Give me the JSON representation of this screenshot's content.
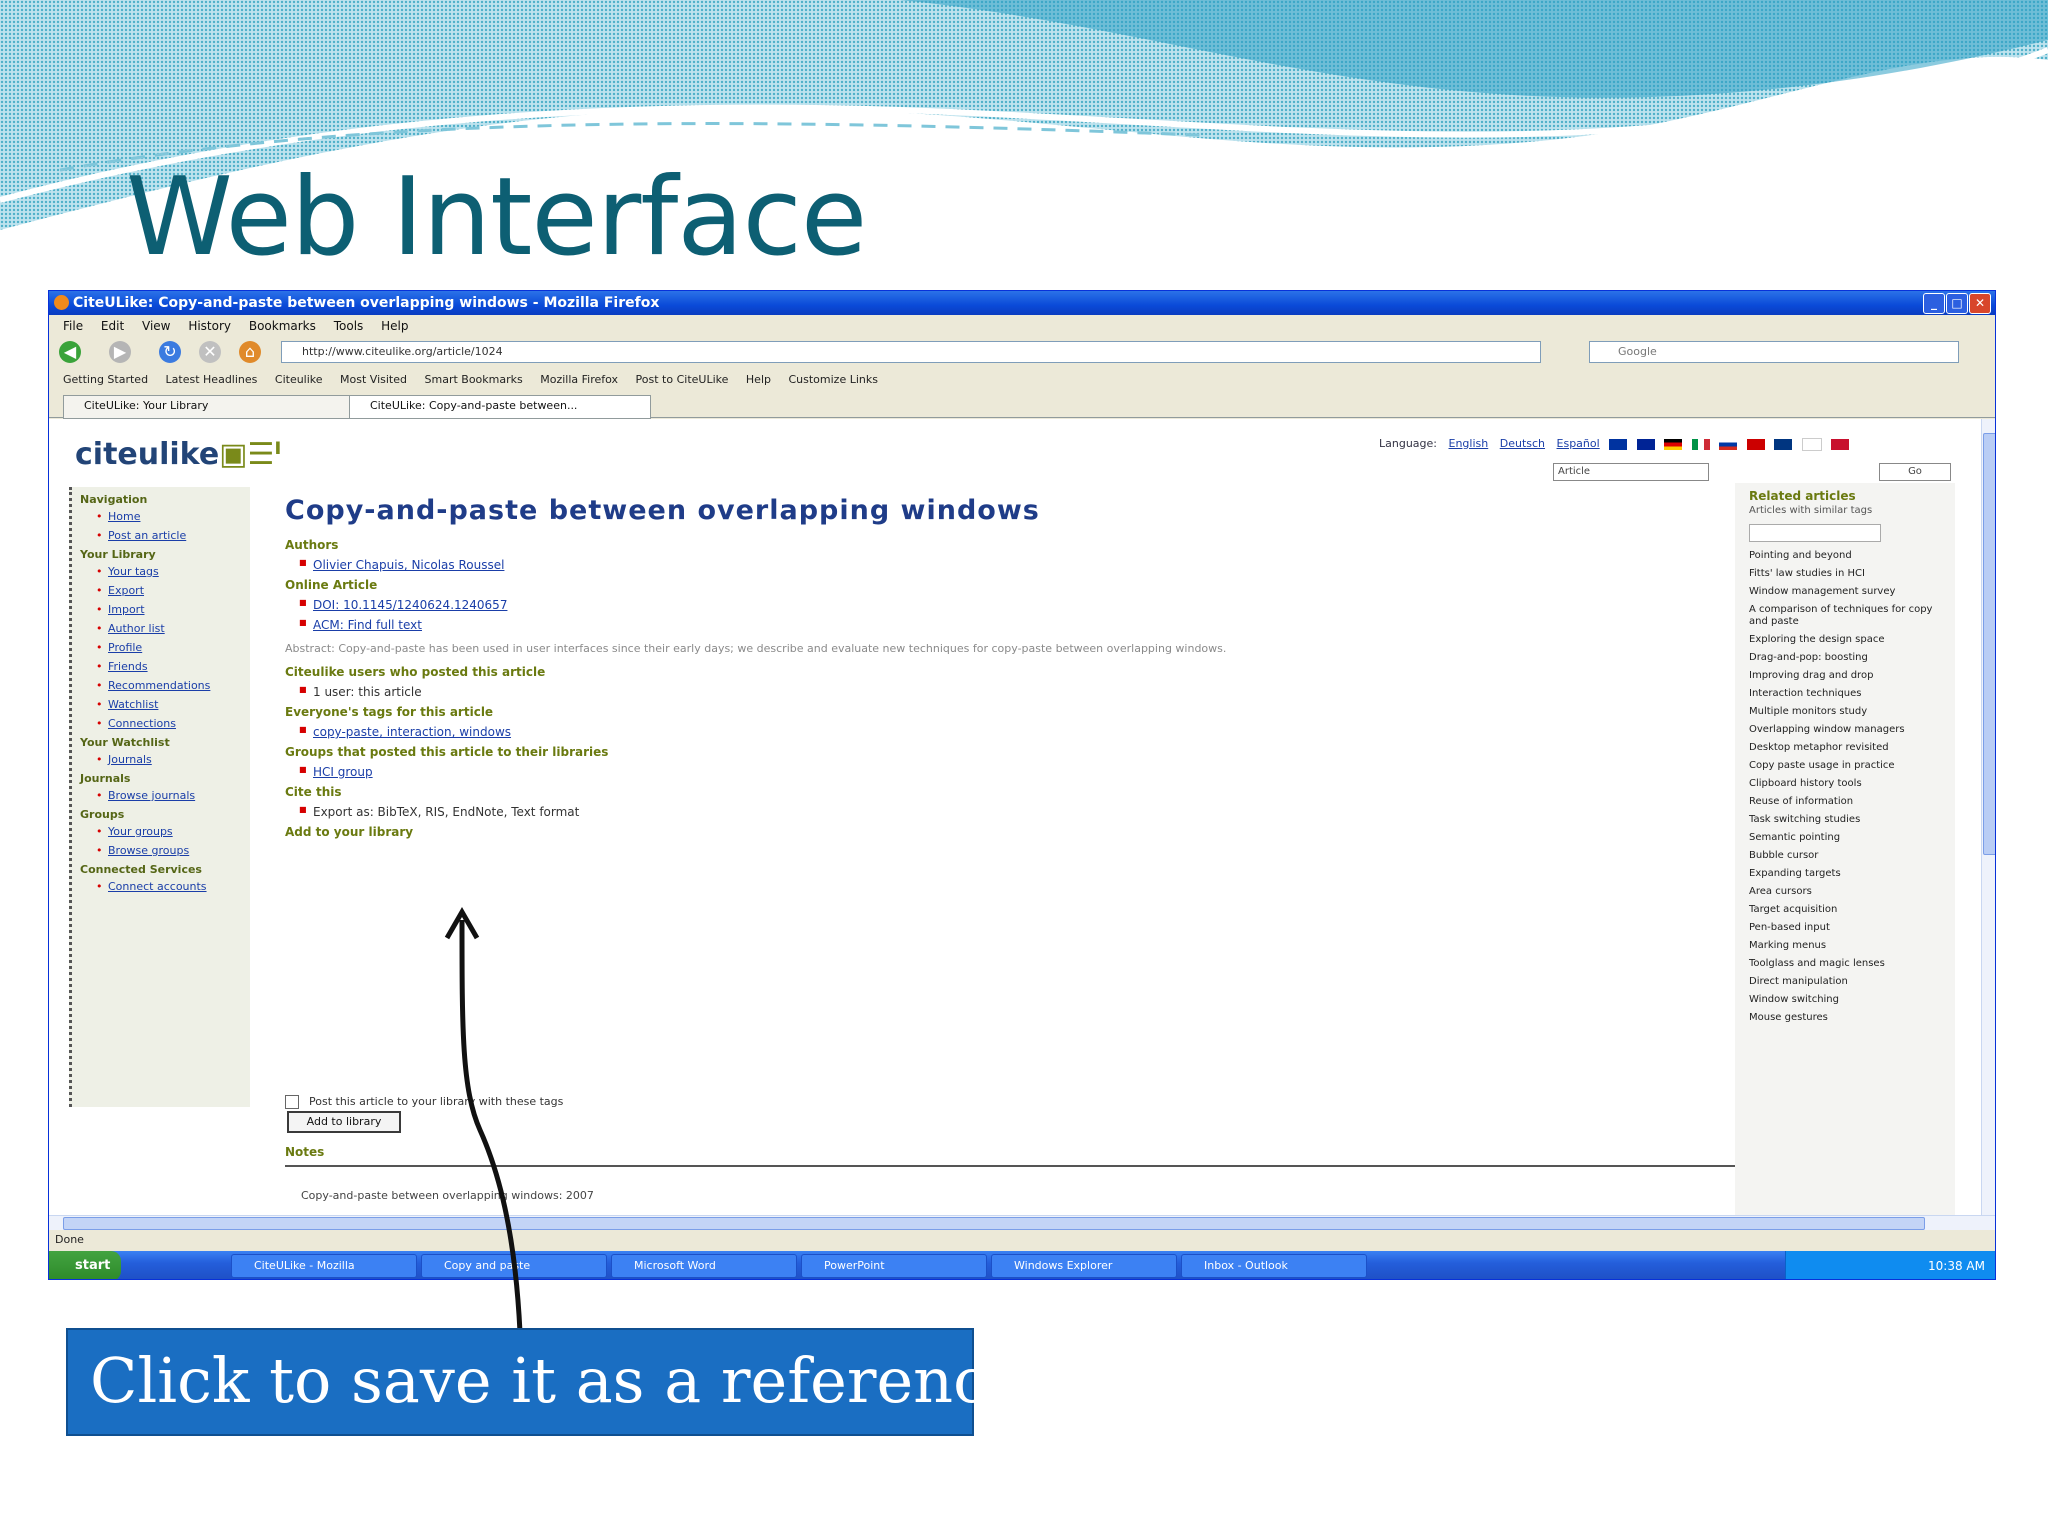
{
  "slide": {
    "title": "Web Interface",
    "callout": "Click to save it as a reference"
  },
  "colors": {
    "title": "#0d5f73",
    "callout_bg": "#1a6ec2",
    "xp_blue": "#0a4ad8",
    "link": "#1a3ea8",
    "label_olive": "#6a7a10",
    "bullet_red": "#d60000"
  },
  "browser": {
    "window_title": "CiteULike: Copy-and-paste between overlapping windows - Mozilla Firefox",
    "menu": [
      "File",
      "Edit",
      "View",
      "History",
      "Bookmarks",
      "Tools",
      "Help"
    ],
    "address": "http://www.citeulike.org/article/1024",
    "search_placeholder": "Google",
    "bookmarks": [
      "Getting Started",
      "Latest Headlines",
      "Citeulike",
      "Most Visited",
      "Smart Bookmarks",
      "Mozilla Firefox",
      "Post to CiteULike",
      "Help",
      "Customize Links"
    ],
    "tabs": [
      "CiteULike: Your Library",
      "CiteULike: Copy-and-paste between..."
    ],
    "status": "Done",
    "icons": [
      "back-arrow-icon",
      "forward-arrow-icon",
      "reload-icon",
      "stop-icon",
      "home-icon"
    ]
  },
  "site": {
    "logo_main": "citeulike",
    "logo_suffix": "▣☰ᴵ",
    "lang_prefix": "Language:",
    "lang_links": [
      "English",
      "Deutsch",
      "Español"
    ],
    "flags": [
      "#0033a0",
      "#002395",
      "#000000",
      "#009246",
      "#d52b1e",
      "#cc0000",
      "#003580",
      "#ffffff",
      "#c8102e"
    ],
    "view_select": "Article",
    "go_label": "Go"
  },
  "leftnav": [
    {
      "type": "sec",
      "label": "Navigation"
    },
    {
      "type": "item",
      "label": "Home"
    },
    {
      "type": "item",
      "label": "Post an article"
    },
    {
      "type": "sec",
      "label": "Your Library"
    },
    {
      "type": "item",
      "label": "Your tags"
    },
    {
      "type": "item",
      "label": "Export"
    },
    {
      "type": "item",
      "label": "Import"
    },
    {
      "type": "item",
      "label": "Author list"
    },
    {
      "type": "item",
      "label": "Profile"
    },
    {
      "type": "item",
      "label": "Friends"
    },
    {
      "type": "item",
      "label": "Recommendations"
    },
    {
      "type": "item",
      "label": "Watchlist"
    },
    {
      "type": "item",
      "label": "Connections"
    },
    {
      "type": "sec",
      "label": "Your Watchlist"
    },
    {
      "type": "item",
      "label": "Journals"
    },
    {
      "type": "sec",
      "label": "Journals"
    },
    {
      "type": "item",
      "label": "Browse journals"
    },
    {
      "type": "sec",
      "label": "Groups"
    },
    {
      "type": "item",
      "label": "Your groups"
    },
    {
      "type": "item",
      "label": "Browse groups"
    },
    {
      "type": "sec",
      "label": "Connected Services"
    },
    {
      "type": "item",
      "label": "Connect accounts"
    }
  ],
  "article": {
    "title": "Copy-and-paste between overlapping windows",
    "authors_label": "Authors",
    "authors": "Olivier Chapuis, Nicolas Roussel",
    "online_label": "Online Article",
    "online_items": [
      "DOI: 10.1145/1240624.1240657",
      "ACM: Find full text"
    ],
    "abstract": "Abstract: Copy-and-paste has been used in user interfaces since their early days; we describe and evaluate new techniques for copy-paste between overlapping windows.",
    "citeulike_users_label": "Citeulike users who posted this article",
    "citeulike_users": "1 user: this article",
    "everyone_label": "Everyone's tags for this article",
    "everyone_tags": "copy-paste, interaction, windows",
    "groups_label": "Groups that posted this article to their libraries",
    "groups_item": "HCI group",
    "cite_label": "Cite this",
    "cite_item": "Export as: BibTeX, RIS, EndNote, Text format",
    "add_library_label": "Add to your library",
    "post_checkbox_label": "Post this article to your library with these tags",
    "add_button": "Add to library",
    "notes_label": "Notes",
    "footline": "Copy-and-paste between overlapping windows: 2007"
  },
  "rightcol": {
    "title": "Related articles",
    "sub": "Articles with similar tags",
    "tags": [
      "Pointing and beyond",
      "Fitts' law studies in HCI",
      "Window management survey",
      "A comparison of techniques for copy and paste",
      "Exploring the design space",
      "Drag-and-pop: boosting",
      "Improving drag and drop",
      "Interaction techniques",
      "Multiple monitors study",
      "Overlapping window managers",
      "Desktop metaphor revisited",
      "Copy paste usage in practice",
      "Clipboard history tools",
      "Reuse of information",
      "Task switching studies",
      "Semantic pointing",
      "Bubble cursor",
      "Expanding targets",
      "Area cursors",
      "Target acquisition",
      "Pen-based input",
      "Marking menus",
      "Toolglass and magic lenses",
      "Direct manipulation",
      "Window switching",
      "Mouse gestures"
    ]
  },
  "taskbar": {
    "start": "start",
    "buttons": [
      "CiteULike - Mozilla",
      "Copy and paste",
      "Microsoft Word",
      "PowerPoint",
      "Windows Explorer",
      "Inbox - Outlook"
    ],
    "clock": "10:38 AM"
  }
}
